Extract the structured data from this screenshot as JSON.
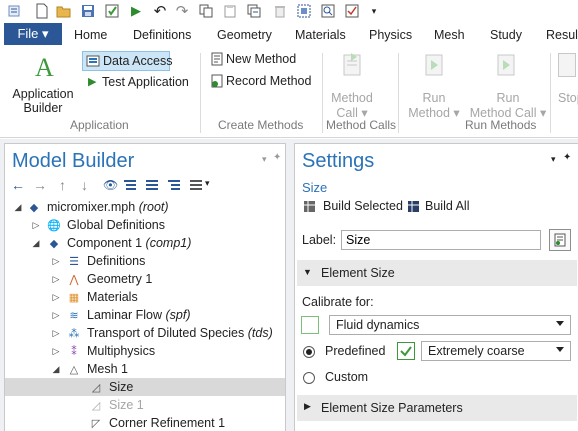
{
  "ribbon_tabs": {
    "file": "File ▾",
    "home": "Home",
    "definitions": "Definitions",
    "geometry": "Geometry",
    "materials": "Materials",
    "physics": "Physics",
    "mesh": "Mesh",
    "study": "Study",
    "results": "Result"
  },
  "ribbon": {
    "app_builder_line1": "Application",
    "app_builder_line2": "Builder",
    "data_access": "Data Access",
    "test_application": "Test Application",
    "group_application": "Application",
    "new_method": "New Method",
    "record_method": "Record Method",
    "group_create_methods": "Create Methods",
    "method_call_line1": "Method",
    "method_call_line2": "Call ▾",
    "group_method_calls": "Method Calls",
    "run_method_line1": "Run",
    "run_method_line2": "Method ▾",
    "run_method_call_line1": "Run",
    "run_method_call_line2": "Method Call ▾",
    "group_run_methods": "Run Methods",
    "stop": "Stop"
  },
  "model_builder": {
    "title": "Model Builder",
    "tree": [
      {
        "label": "micromixer.mph",
        "tag": "(root)"
      },
      {
        "label": "Global Definitions",
        "tag": ""
      },
      {
        "label": "Component 1",
        "tag": "(comp1)"
      },
      {
        "label": "Definitions",
        "tag": ""
      },
      {
        "label": "Geometry 1",
        "tag": ""
      },
      {
        "label": "Materials",
        "tag": ""
      },
      {
        "label": "Laminar Flow",
        "tag": "(spf)"
      },
      {
        "label": "Transport of Diluted Species",
        "tag": "(tds)"
      },
      {
        "label": "Multiphysics",
        "tag": ""
      },
      {
        "label": "Mesh 1",
        "tag": ""
      },
      {
        "label": "Size",
        "tag": ""
      },
      {
        "label": "Size 1",
        "tag": ""
      },
      {
        "label": "Corner Refinement 1",
        "tag": ""
      }
    ]
  },
  "settings": {
    "title": "Settings",
    "subtitle": "Size",
    "build_selected": "Build Selected",
    "build_all": "Build All",
    "label_caption": "Label:",
    "label_value": "Size",
    "section_element_size": "Element Size",
    "calibrate_for": "Calibrate for:",
    "calibrate_value": "Fluid dynamics",
    "predefined": "Predefined",
    "predefined_value": "Extremely coarse",
    "custom": "Custom",
    "section_params": "Element Size Parameters"
  },
  "colors": {
    "accent": "#2b73b8",
    "file_tab": "#2b5797",
    "selected_row": "#d9d9d9",
    "highlight": "#cde6f7"
  }
}
